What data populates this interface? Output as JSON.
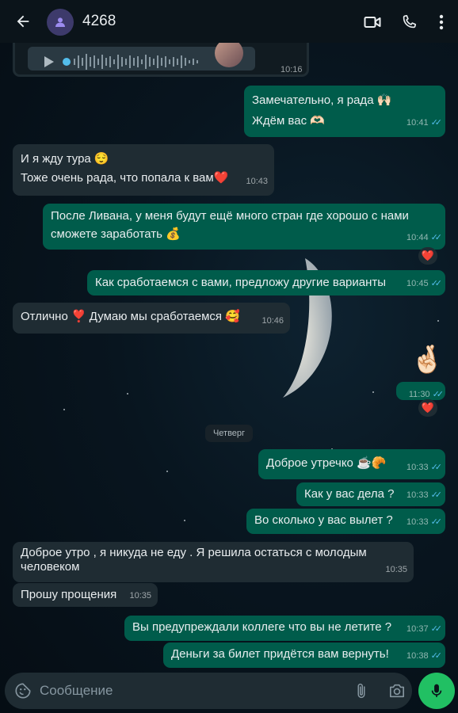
{
  "header": {
    "title": "4268"
  },
  "voice": {
    "time": "10:16"
  },
  "messages": [
    {
      "lines": [
        "Замечательно, я рада 🙌🏻",
        "Ждём вас 🫶🏻"
      ],
      "time": "10:41"
    },
    {
      "lines": [
        "И я жду тура 😌",
        "Тоже очень рада, что попала к вам❤️"
      ],
      "time": "10:43"
    },
    {
      "lines": [
        "После Ливана, у меня будут ещё много стран где хорошо с нами",
        "сможете заработать 💰"
      ],
      "time": "10:44",
      "reaction": "❤️"
    },
    {
      "lines": [
        "Как сработаемся с вами, предложу другие варианты"
      ],
      "time": "10:45"
    },
    {
      "lines": [
        "Отлично ❣️ Думаю мы сработаемся 🥰"
      ],
      "time": "10:46"
    },
    {
      "lines": [
        "🤞🏻"
      ],
      "time": "11:30",
      "reaction": "❤️"
    },
    {
      "lines": [
        "Доброе утречко ☕🥐"
      ],
      "time": "10:33"
    },
    {
      "lines": [
        "Как у вас дела ?"
      ],
      "time": "10:33"
    },
    {
      "lines": [
        "Во сколько у вас вылет ?"
      ],
      "time": "10:33"
    },
    {
      "lines": [
        "Доброе утро , я никуда не еду . Я решила остаться с молодым",
        "человеком"
      ],
      "time": "10:35"
    },
    {
      "lines": [
        "Прошу прощения"
      ],
      "time": "10:35"
    },
    {
      "lines": [
        "Вы предупреждали коллеге что вы не летите ?"
      ],
      "time": "10:37"
    },
    {
      "lines": [
        "Деньги за билет придётся вам вернуть!"
      ],
      "time": "10:38"
    }
  ],
  "day_chip": "Четверг",
  "composer": {
    "placeholder": "Сообщение"
  },
  "icons": {
    "back": "arrow-back-icon",
    "video": "video-call-icon",
    "call": "phone-icon",
    "more": "more-vert-icon",
    "emoji": "sticker-icon",
    "attach": "paperclip-icon",
    "camera": "camera-icon",
    "mic": "microphone-icon"
  },
  "colors": {
    "incoming": "#1f2c33",
    "outgoing": "#005c4b",
    "accent": "#21c063",
    "read_ticks": "#53bdeb"
  }
}
